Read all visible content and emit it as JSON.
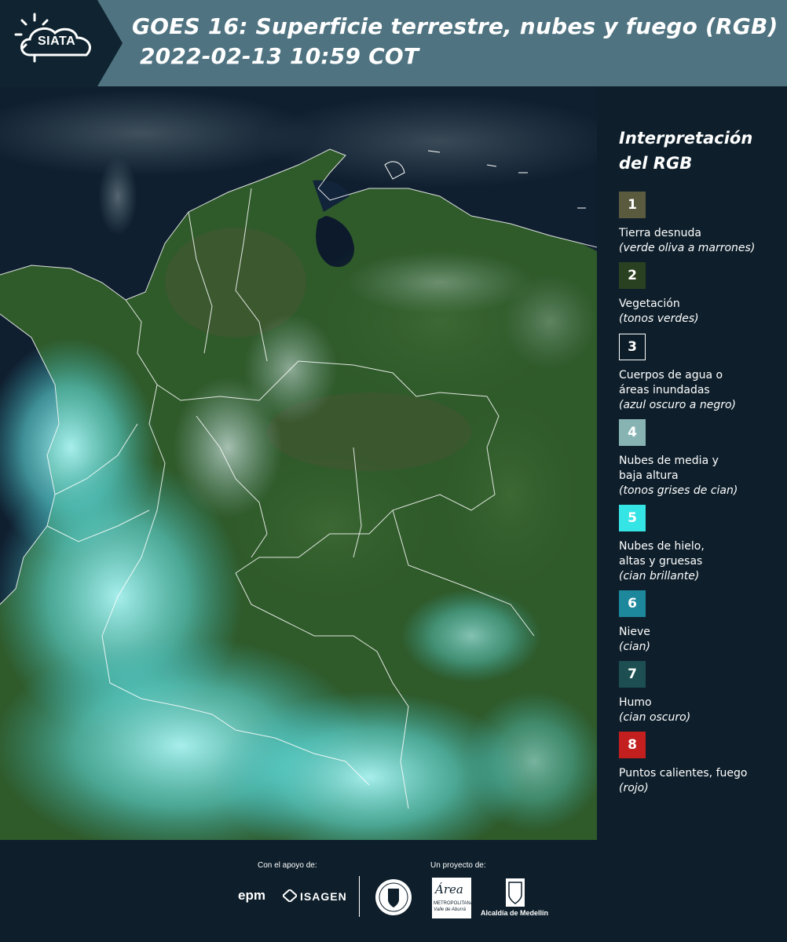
{
  "header": {
    "logo_text": "SIATA",
    "title_line1": "GOES 16: Superficie terrestre, nubes y fuego (RGB)",
    "title_line2": "2022-02-13 10:59 COT"
  },
  "legend": {
    "title_line1": "Interpretación",
    "title_line2": "del RGB",
    "items": [
      {
        "number": "1",
        "color": "#5a5b3e",
        "label_lines": [
          "Tierra desnuda"
        ],
        "desc": "(verde oliva a marrones)"
      },
      {
        "number": "2",
        "color": "#2a4121",
        "label_lines": [
          "Vegetación"
        ],
        "desc": "(tonos verdes)"
      },
      {
        "number": "3",
        "color": "#0c1d29",
        "label_lines": [
          "Cuerpos de agua o",
          "áreas inundadas"
        ],
        "desc": "(azul oscuro a negro)"
      },
      {
        "number": "4",
        "color": "#87b3b3",
        "label_lines": [
          "Nubes de media y",
          "baja altura"
        ],
        "desc": "(tonos grises de cian)"
      },
      {
        "number": "5",
        "color": "#35e4e4",
        "label_lines": [
          "Nubes de hielo,",
          "altas y gruesas"
        ],
        "desc": "(cian brillante)"
      },
      {
        "number": "6",
        "color": "#1d879c",
        "label_lines": [
          "Nieve"
        ],
        "desc": "(cian)"
      },
      {
        "number": "7",
        "color": "#1c4e52",
        "label_lines": [
          "Humo"
        ],
        "desc": "(cian oscuro)"
      },
      {
        "number": "8",
        "color": "#c41f1f",
        "label_lines": [
          "Puntos calientes, fuego"
        ],
        "desc": "(rojo)"
      }
    ]
  },
  "footer": {
    "support_label": "Con el apoyo de:",
    "project_label": "Un proyecto de:",
    "sponsor_epm": "epm",
    "sponsor_isagen": "ISAGEN",
    "area_logo_text": "Área",
    "area_logo_sub1": "METROPOLITANA",
    "area_logo_sub2": "Valle de Aburrá",
    "alcaldia_text": "Alcaldía de Medellín"
  },
  "colors": {
    "header_bg": "#4f7380",
    "logo_bg": "#0f2430",
    "page_bg": "#0e1f2b",
    "vegetation": "#2f5a2a",
    "ocean": "#101f30",
    "cloud": "#6fe8e8"
  }
}
